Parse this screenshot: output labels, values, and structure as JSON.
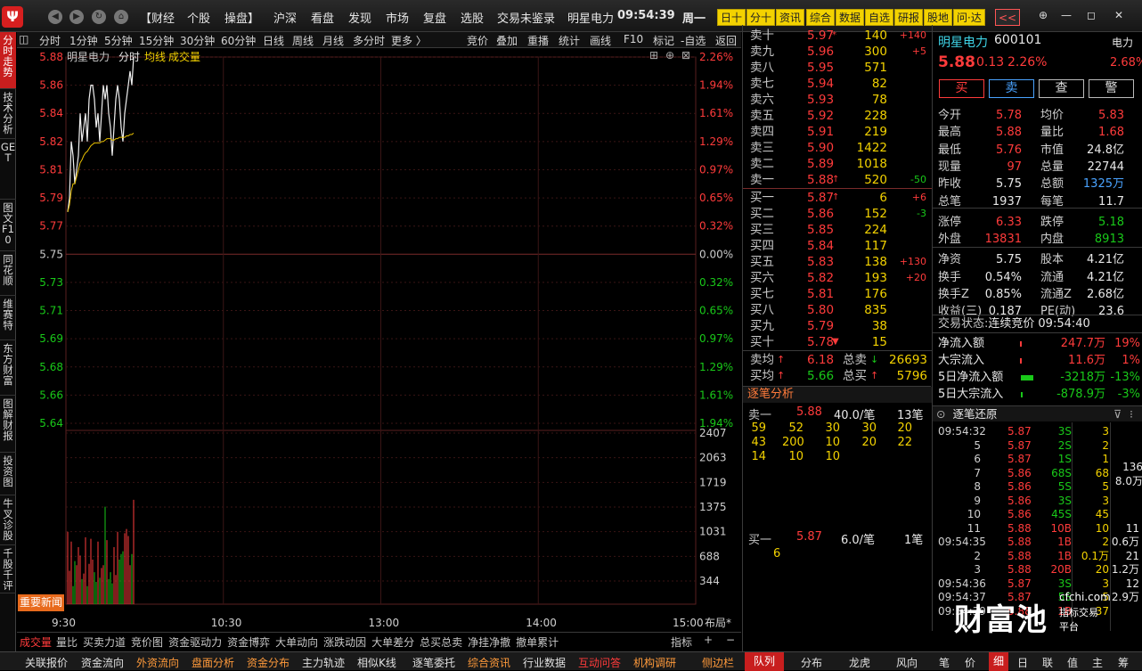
{
  "topbar": {
    "logo": "Ψ",
    "menu": [
      "【财经",
      "个股",
      "操盘】",
      "沪深",
      "看盘",
      "发现",
      "市场",
      "复盘",
      "选股"
    ],
    "alert": "交易未鉴录",
    "stock_name": "明星电力",
    "clock": "09:54:39",
    "weekday": "周一",
    "tabs": [
      "日十",
      "分十",
      "资讯",
      "综合",
      "数据",
      "自选",
      "研报",
      "股地",
      "问·达",
      "<<"
    ],
    "window": [
      "⊕",
      "—",
      "◻",
      "✕"
    ]
  },
  "side_tabs": [
    "分时走势",
    "技术分析",
    "GET",
    "图文F10",
    "同花顺",
    "维赛特",
    "东方财富",
    "图解财报",
    "投资图",
    "牛叉诊股",
    "千股千评"
  ],
  "chart_toolbar": {
    "periods": [
      "分时",
      "1分钟",
      "5分钟",
      "15分钟",
      "30分钟",
      "60分钟",
      "日线",
      "周线",
      "月线",
      "多分时",
      "更多 〉"
    ],
    "tools": [
      "竞价",
      "叠加",
      "重播",
      "统计",
      "画线",
      "F10",
      "标记",
      "-自选",
      "返回"
    ]
  },
  "chart_header": {
    "name": "明星电力",
    "mode": "分时",
    "avg_line": "均线",
    "volume": "成交量"
  },
  "news_button": "重要新闻",
  "chart_data": {
    "type": "line",
    "price_ticks": [
      "5.88",
      "5.86",
      "5.84",
      "5.82",
      "5.81",
      "5.79",
      "5.77",
      "5.75",
      "5.73",
      "5.71",
      "5.69",
      "5.68",
      "5.66",
      "5.64"
    ],
    "pct_ticks": [
      "2.26%",
      "1.94%",
      "1.61%",
      "1.29%",
      "0.97%",
      "0.65%",
      "0.32%",
      "0.00%",
      "0.32%",
      "0.65%",
      "0.97%",
      "1.29%",
      "1.61%",
      "1.94%"
    ],
    "ylim": [
      5.62,
      5.88
    ],
    "vol_ticks": [
      "2407",
      "2063",
      "1719",
      "1375",
      "1031",
      "688",
      "344"
    ],
    "vol_max": 2407,
    "time_ticks": [
      "9:30",
      "10:30",
      "13:00",
      "14:00",
      "15:00"
    ],
    "time_right": "布局*",
    "price": [
      5.77,
      5.78,
      5.82,
      5.81,
      5.79,
      5.8,
      5.81,
      5.84,
      5.82,
      5.83,
      5.84,
      5.82,
      5.85,
      5.86,
      5.86,
      5.85,
      5.83,
      5.84,
      5.82,
      5.84,
      5.86,
      5.85,
      5.86,
      5.84,
      5.83,
      5.81,
      5.83,
      5.85,
      5.86,
      5.85,
      5.83,
      5.82,
      5.84,
      5.85,
      5.86,
      5.87,
      5.86,
      5.88
    ],
    "avg": [
      5.77,
      5.775,
      5.785,
      5.79,
      5.79,
      5.795,
      5.8,
      5.805,
      5.807,
      5.81,
      5.812,
      5.813,
      5.815,
      5.817,
      5.818,
      5.819,
      5.819,
      5.819,
      5.819,
      5.82,
      5.82,
      5.821,
      5.822,
      5.822,
      5.822,
      5.821,
      5.821,
      5.822,
      5.822,
      5.823,
      5.823,
      5.823,
      5.823,
      5.824,
      5.824,
      5.825,
      5.825,
      5.826
    ],
    "volume": [
      1040,
      480,
      900,
      260,
      620,
      560,
      820,
      700,
      360,
      440,
      960,
      260,
      580,
      940,
      640,
      460,
      320,
      900,
      380,
      520,
      560,
      1400,
      920,
      360,
      460,
      300,
      820,
      420,
      1040,
      640,
      720,
      760,
      1020,
      1080,
      980,
      560,
      720,
      1500
    ]
  },
  "chart_bottom_tabs": [
    "成交量",
    "量比",
    "买卖力道",
    "竞价图",
    "资金驱动力",
    "资金博弈",
    "大单动向",
    "涨跌动因",
    "大单差分",
    "总买总卖",
    "净挂净撤",
    "撤单累计"
  ],
  "chart_bottom_right": [
    "指标",
    "+",
    "−"
  ],
  "footer": [
    "关联报价",
    "资金流向",
    "外资流向",
    "盘面分析",
    "资金分布",
    "主力轨迹",
    "相似K线",
    "逐笔委托",
    "综合资讯",
    "行业数据",
    "互动问答",
    "机构调研",
    "侧边栏",
    "队列",
    "分布",
    "龙虎",
    "风向",
    "笔",
    "价",
    "细",
    "日",
    "联",
    "值",
    "主",
    "筹"
  ],
  "orderbook": {
    "asks": [
      {
        "label": "卖十",
        "price": "5.97",
        "arrow": "*",
        "vol": "140",
        "chg": "+140"
      },
      {
        "label": "卖九",
        "price": "5.96",
        "arrow": "",
        "vol": "300",
        "chg": "+5"
      },
      {
        "label": "卖八",
        "price": "5.95",
        "arrow": "",
        "vol": "571",
        "chg": ""
      },
      {
        "label": "卖七",
        "price": "5.94",
        "arrow": "",
        "vol": "82",
        "chg": ""
      },
      {
        "label": "卖六",
        "price": "5.93",
        "arrow": "",
        "vol": "78",
        "chg": ""
      },
      {
        "label": "卖五",
        "price": "5.92",
        "arrow": "",
        "vol": "228",
        "chg": ""
      },
      {
        "label": "卖四",
        "price": "5.91",
        "arrow": "",
        "vol": "219",
        "chg": ""
      },
      {
        "label": "卖三",
        "price": "5.90",
        "arrow": "",
        "vol": "1422",
        "chg": ""
      },
      {
        "label": "卖二",
        "price": "5.89",
        "arrow": "",
        "vol": "1018",
        "chg": ""
      },
      {
        "label": "卖一",
        "price": "5.88",
        "arrow": "↑",
        "vol": "520",
        "chg": "-50"
      }
    ],
    "bids": [
      {
        "label": "买一",
        "price": "5.87",
        "arrow": "↑",
        "vol": "6",
        "chg": "+6"
      },
      {
        "label": "买二",
        "price": "5.86",
        "arrow": "",
        "vol": "152",
        "chg": "-3"
      },
      {
        "label": "买三",
        "price": "5.85",
        "arrow": "",
        "vol": "224",
        "chg": ""
      },
      {
        "label": "买四",
        "price": "5.84",
        "arrow": "",
        "vol": "117",
        "chg": ""
      },
      {
        "label": "买五",
        "price": "5.83",
        "arrow": "",
        "vol": "138",
        "chg": "+130"
      },
      {
        "label": "买六",
        "price": "5.82",
        "arrow": "",
        "vol": "193",
        "chg": "+20"
      },
      {
        "label": "买七",
        "price": "5.81",
        "arrow": "",
        "vol": "176",
        "chg": ""
      },
      {
        "label": "买八",
        "price": "5.80",
        "arrow": "",
        "vol": "835",
        "chg": ""
      },
      {
        "label": "买九",
        "price": "5.79",
        "arrow": "",
        "vol": "38",
        "chg": ""
      },
      {
        "label": "买十",
        "price": "5.78",
        "arrow": "▼",
        "vol": "15",
        "chg": ""
      }
    ],
    "avg_sell_label": "卖均",
    "avg_sell": "6.18",
    "total_sell_label": "总卖",
    "total_sell": "26693",
    "avg_buy_label": "买均",
    "avg_buy": "5.66",
    "total_buy_label": "总买",
    "total_buy": "5796"
  },
  "tick_analysis": {
    "title": "逐笔分析",
    "sell_label": "卖一",
    "sell_price": "5.88",
    "sell_avg": "40.0/笔",
    "sell_count": "13笔",
    "sell_rows": [
      [
        "59",
        "52",
        "30",
        "30",
        "20"
      ],
      [
        "43",
        "200",
        "10",
        "20",
        "22"
      ],
      [
        "14",
        "10",
        "10",
        "",
        ""
      ]
    ],
    "buy_label": "买一",
    "buy_price": "5.87",
    "buy_avg": "6.0/笔",
    "buy_count": "1笔",
    "buy_rows": [
      [
        "6"
      ]
    ]
  },
  "quote": {
    "name": "明星电力",
    "code": "600101",
    "sector": "电力",
    "price": "5.88",
    "change": "0.13",
    "pct": "2.26%",
    "sector_pct": "2.68%",
    "actions": [
      "买",
      "卖",
      "查",
      "警"
    ],
    "rows": [
      [
        [
          "今开",
          "5.78",
          "red"
        ],
        [
          "均价",
          "5.83",
          "red"
        ]
      ],
      [
        [
          "最高",
          "5.88",
          "red"
        ],
        [
          "量比",
          "1.68",
          "red"
        ]
      ],
      [
        [
          "最低",
          "5.76",
          "red"
        ],
        [
          "市值",
          "24.8亿",
          "white"
        ]
      ],
      [
        [
          "现量",
          "97",
          "red"
        ],
        [
          "总量",
          "22744",
          "white"
        ]
      ],
      [
        [
          "昨收",
          "5.75",
          "white"
        ],
        [
          "总额",
          "1325万",
          "blue"
        ]
      ],
      [
        [
          "总笔",
          "1937",
          "white"
        ],
        [
          "每笔",
          "11.7",
          "white"
        ]
      ],
      [
        [
          "涨停",
          "6.33",
          "red"
        ],
        [
          "跌停",
          "5.18",
          "green"
        ]
      ],
      [
        [
          "外盘",
          "13831",
          "red"
        ],
        [
          "内盘",
          "8913",
          "green"
        ]
      ],
      [
        [
          "净资",
          "5.75",
          "white"
        ],
        [
          "股本",
          "4.21亿",
          "white"
        ]
      ],
      [
        [
          "换手",
          "0.54%",
          "white"
        ],
        [
          "流通",
          "4.21亿",
          "white"
        ]
      ],
      [
        [
          "换手Z",
          "0.85%",
          "white"
        ],
        [
          "流通Z",
          "2.68亿",
          "white"
        ]
      ],
      [
        [
          "收益(三)",
          "0.187",
          "white"
        ],
        [
          "PE(动)",
          "23.6",
          "white"
        ]
      ]
    ],
    "status_label": "交易状态:",
    "status": "连续竞价",
    "status_time": "09:54:40",
    "flows": [
      {
        "label": "净流入额",
        "value": "247.7万",
        "pct": "19%",
        "color": "red"
      },
      {
        "label": "大宗流入",
        "value": "11.6万",
        "pct": "1%",
        "color": "red"
      },
      {
        "label": "5日净流入额",
        "value": "-3218万",
        "pct": "-13%",
        "color": "green"
      },
      {
        "label": "5日大宗流入",
        "value": "-878.9万",
        "pct": "-3%",
        "color": "green"
      }
    ],
    "tick_title": "逐笔还原",
    "ticks": [
      [
        "09:54:32",
        "5.87",
        "3S",
        "3",
        ""
      ],
      [
        "5",
        "5.87",
        "2S",
        "2",
        ""
      ],
      [
        "6",
        "5.87",
        "1S",
        "1",
        ""
      ],
      [
        "7",
        "5.86",
        "68S",
        "68",
        ""
      ],
      [
        "8",
        "5.86",
        "5S",
        "5",
        ""
      ],
      [
        "9",
        "5.86",
        "3S",
        "3",
        ""
      ],
      [
        "10",
        "5.86",
        "45S",
        "45",
        ""
      ],
      [
        "11",
        "5.88",
        "10B",
        "10",
        "11"
      ],
      [
        "09:54:35",
        "5.88",
        "1B",
        "2",
        "0.6万"
      ],
      [
        "2",
        "5.88",
        "1B",
        "0.1万",
        "21"
      ],
      [
        "3",
        "5.88",
        "20B",
        "20",
        "1.2万"
      ],
      [
        "09:54:36",
        "5.87",
        "3S",
        "3",
        "12"
      ],
      [
        "09:54:37",
        "5.87",
        "5S",
        "5",
        "2.9万"
      ],
      [
        "09:54:39",
        "5.88",
        "1B",
        "37",
        ""
      ]
    ],
    "tick_side": [
      "136",
      "8.0万"
    ],
    "watermark": "财富池",
    "watermark_url": "cfchi.com",
    "watermark_sub": "指标交易平台"
  }
}
